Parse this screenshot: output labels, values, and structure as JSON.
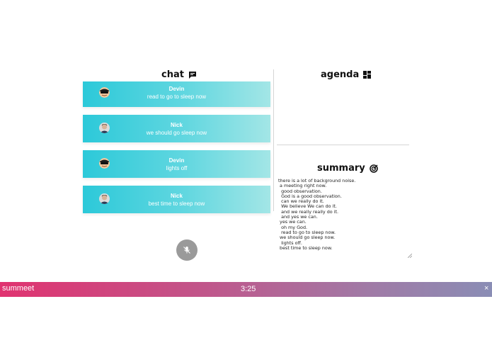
{
  "chat": {
    "heading": "chat",
    "icon": "chat-bubble-icon",
    "messages": [
      {
        "name": "Devin",
        "text": "read to go to sleep now",
        "avatar": "avatar-sunglasses"
      },
      {
        "name": "Nick",
        "text": "we should go sleep now",
        "avatar": "avatar-photo"
      },
      {
        "name": "Devin",
        "text": "lights off",
        "avatar": "avatar-sunglasses"
      },
      {
        "name": "Nick",
        "text": "best time to sleep now",
        "avatar": "avatar-photo"
      }
    ]
  },
  "agenda": {
    "heading": "agenda",
    "icon": "dashboard-icon"
  },
  "summary": {
    "heading": "summary",
    "icon": "target-icon",
    "text": "there is a lot of background noise.\n a meeting right now.\n  good observation.\n  God is a good observation.\n  can we really do it.\n  We believe We can do it.\n  and we really really do it.\n  and yes we can.\n yes we can.\n  oh my God.\n  read to go to sleep now.\n we should go sleep now.\n  lights off.\n best time to sleep now."
  },
  "controls": {
    "mic_icon": "mic-off-icon"
  },
  "footer": {
    "brand": "summeet",
    "timer": "3:25",
    "close_label": "×"
  },
  "colors": {
    "chat_gradient_start": "#2cc9d9",
    "chat_gradient_end": "#a3e6e6",
    "footer_gradient_start": "#e03370",
    "footer_gradient_end": "#8a8db5",
    "mic_button": "#9a9a9a"
  }
}
